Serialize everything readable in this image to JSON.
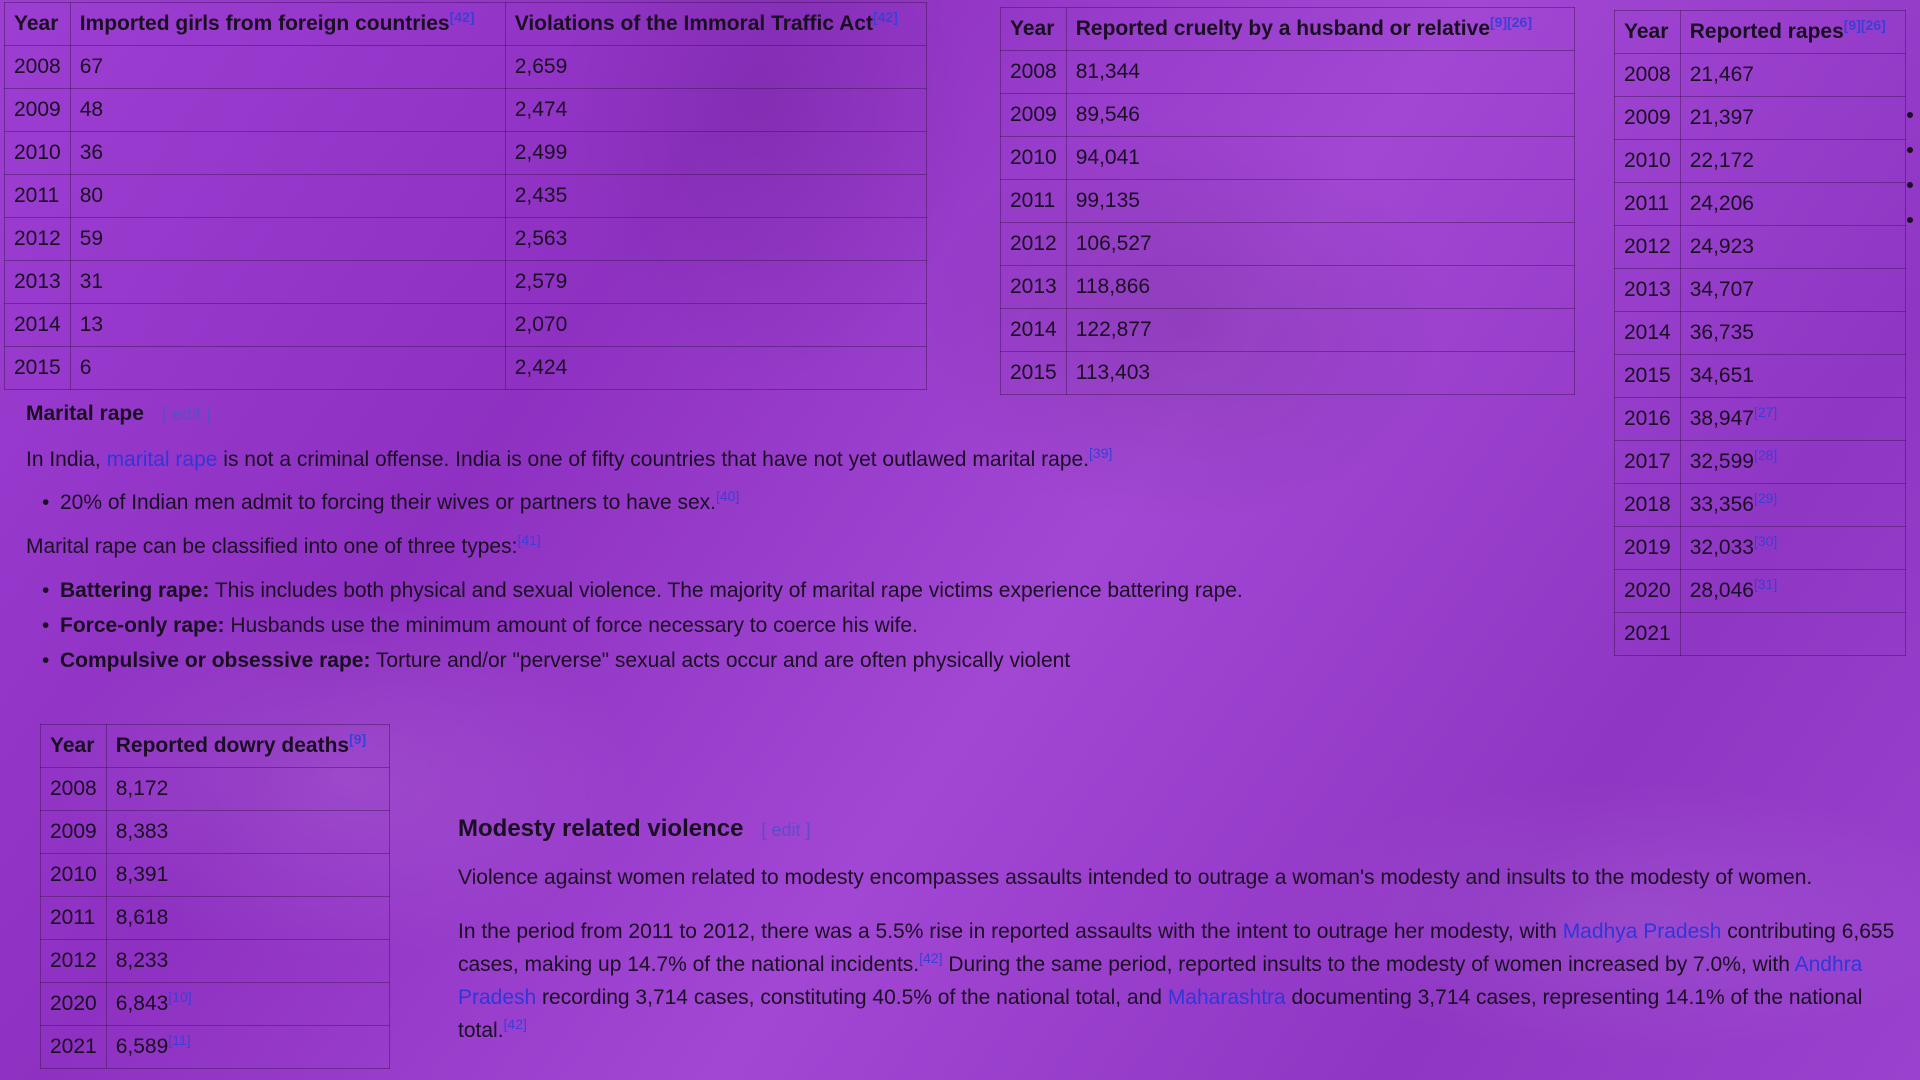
{
  "trafficking_table": {
    "headers": {
      "year": "Year",
      "col1": "Imported girls from foreign countries",
      "col1_ref": "[42]",
      "col2": "Violations of the Immoral Traffic Act",
      "col2_ref": "[42]"
    },
    "rows": [
      [
        "2008",
        "67",
        "2,659"
      ],
      [
        "2009",
        "48",
        "2,474"
      ],
      [
        "2010",
        "36",
        "2,499"
      ],
      [
        "2011",
        "80",
        "2,435"
      ],
      [
        "2012",
        "59",
        "2,563"
      ],
      [
        "2013",
        "31",
        "2,579"
      ],
      [
        "2014",
        "13",
        "2,070"
      ],
      [
        "2015",
        "6",
        "2,424"
      ]
    ]
  },
  "cruelty_table": {
    "headers": {
      "year": "Year",
      "col1": "Reported cruelty by a husband or relative",
      "col1_ref": "[9][26]"
    },
    "rows": [
      [
        "2008",
        "81,344"
      ],
      [
        "2009",
        "89,546"
      ],
      [
        "2010",
        "94,041"
      ],
      [
        "2011",
        "99,135"
      ],
      [
        "2012",
        "106,527"
      ],
      [
        "2013",
        "118,866"
      ],
      [
        "2014",
        "122,877"
      ],
      [
        "2015",
        "113,403"
      ]
    ]
  },
  "rapes_table": {
    "headers": {
      "year": "Year",
      "col1": "Reported rapes",
      "col1_ref": "[9][26]"
    },
    "rows": [
      [
        "2008",
        "21,467",
        ""
      ],
      [
        "2009",
        "21,397",
        ""
      ],
      [
        "2010",
        "22,172",
        ""
      ],
      [
        "2011",
        "24,206",
        ""
      ],
      [
        "2012",
        "24,923",
        ""
      ],
      [
        "2013",
        "34,707",
        ""
      ],
      [
        "2014",
        "36,735",
        ""
      ],
      [
        "2015",
        "34,651",
        ""
      ],
      [
        "2016",
        "38,947",
        "[27]"
      ],
      [
        "2017",
        "32,599",
        "[28]"
      ],
      [
        "2018",
        "33,356",
        "[29]"
      ],
      [
        "2019",
        "32,033",
        "[30]"
      ],
      [
        "2020",
        "28,046",
        "[31]"
      ],
      [
        "2021",
        "",
        ""
      ]
    ]
  },
  "dowry_table": {
    "headers": {
      "year": "Year",
      "col1": "Reported dowry deaths",
      "col1_ref": "[9]"
    },
    "rows": [
      [
        "2008",
        "8,172",
        ""
      ],
      [
        "2009",
        "8,383",
        ""
      ],
      [
        "2010",
        "8,391",
        ""
      ],
      [
        "2011",
        "8,618",
        ""
      ],
      [
        "2012",
        "8,233",
        ""
      ],
      [
        "2020",
        "6,843",
        "[10]"
      ],
      [
        "2021",
        "6,589",
        "[11]"
      ]
    ]
  },
  "marital_rape": {
    "heading": "Marital rape",
    "edit": "[ edit ]",
    "intro_pre": "In India, ",
    "intro_link": "marital rape",
    "intro_post": " is not a criminal offense. India is one of fifty countries that have not yet outlawed marital rape.",
    "intro_ref": "[39]",
    "stat": "20% of Indian men admit to forcing their wives or partners to have sex.",
    "stat_ref": "[40]",
    "types_intro": "Marital rape can be classified into one of three types:",
    "types_ref": "[41]",
    "types": [
      {
        "term": "Battering rape:",
        "desc": " This includes both physical and sexual violence. The majority of marital rape victims experience battering rape."
      },
      {
        "term": "Force-only rape:",
        "desc": " Husbands use the minimum amount of force necessary to coerce his wife."
      },
      {
        "term": "Compulsive or obsessive rape:",
        "desc": " Torture and/or \"perverse\" sexual acts occur and are often physically violent"
      }
    ]
  },
  "modesty": {
    "heading": "Modesty related violence",
    "edit": "[ edit ]",
    "para1": "Violence against women related to modesty encompasses assaults intended to outrage a woman's modesty and insults to the modesty of women.",
    "p2_a": "In the period from 2011 to 2012, there was a 5.5% rise in reported assaults with the intent to outrage her modesty, with ",
    "p2_link1": "Madhya Pradesh",
    "p2_b": " contributing 6,655 cases, making up 14.7% of the national incidents.",
    "p2_ref1": "[42]",
    "p2_c": " During the same period, reported insults to the modesty of women increased by 7.0%, with ",
    "p2_link2": "Andhra Pradesh",
    "p2_d": " recording 3,714 cases, constituting 40.5% of the national total, and ",
    "p2_link3": "Maharashtra",
    "p2_e": " documenting 3,714 cases, representing 14.1% of the national total.",
    "p2_ref2": "[42]"
  }
}
